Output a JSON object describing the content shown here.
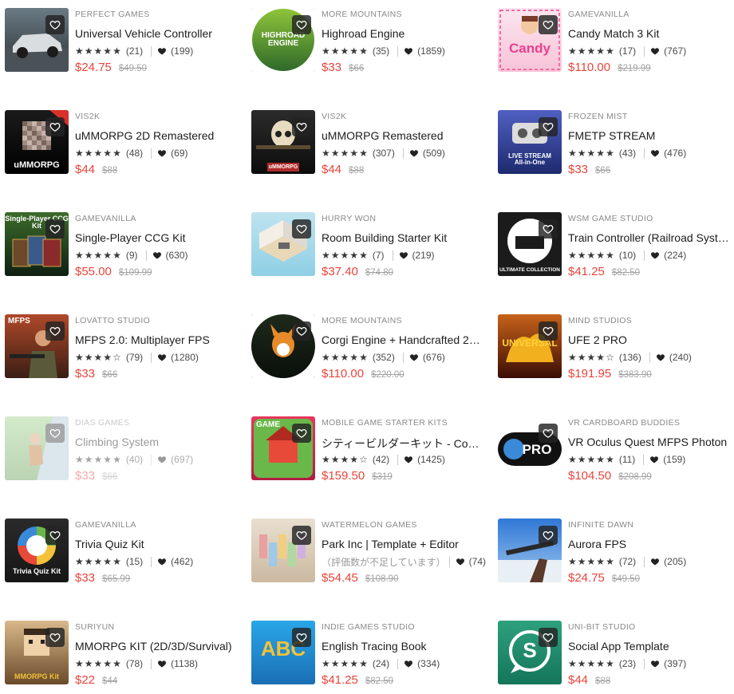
{
  "colors": {
    "sale": "#e8453c",
    "accent": "#212121"
  },
  "cards": [
    {
      "publisher": "PERFECT GAMES",
      "title": "Universal Vehicle Controller",
      "rating": 5,
      "reviews": "(21)",
      "favorites": "(199)",
      "price": "$24.75",
      "original": "$49.50",
      "thumb_icon": "car-thumbnail-icon",
      "bg1": "#6a7b85",
      "bg2": "#2c3134",
      "label": ""
    },
    {
      "publisher": "MORE MOUNTAINS",
      "title": "Highroad Engine",
      "rating": 5,
      "reviews": "(35)",
      "favorites": "(1859)",
      "price": "$33",
      "original": "$66",
      "thumb_icon": "highroad-logo-icon",
      "bg1": "#8fc43a",
      "bg2": "#2e6a2a",
      "label": "HIGHROAD ENGINE"
    },
    {
      "publisher": "GAMEVANILLA",
      "title": "Candy Match 3 Kit",
      "rating": 5,
      "reviews": "(17)",
      "favorites": "(767)",
      "price": "$110.00",
      "original": "$219.99",
      "thumb_icon": "candy-logo-icon",
      "bg1": "#fbe6ef",
      "bg2": "#f8c3d8",
      "label": "Candy"
    },
    {
      "publisher": "VIS2K",
      "title": "uMMORPG 2D Remastered",
      "rating": 5,
      "reviews": "(48)",
      "favorites": "(69)",
      "price": "$44",
      "original": "$88",
      "thumb_icon": "pixel-skull-icon",
      "bg1": "#1b1b1b",
      "bg2": "#000000",
      "label": "uMMORPG"
    },
    {
      "publisher": "VIS2K",
      "title": "uMMORPG Remastered",
      "rating": 5,
      "reviews": "(307)",
      "favorites": "(509)",
      "price": "$44",
      "original": "$88",
      "thumb_icon": "skull-icon",
      "bg1": "#2b2b2b",
      "bg2": "#0c0c0c",
      "label": "uMMORPG"
    },
    {
      "publisher": "FROZEN MIST",
      "title": "FMETP STREAM",
      "rating": 5,
      "reviews": "(43)",
      "favorites": "(476)",
      "price": "$33",
      "original": "$66",
      "thumb_icon": "vr-headset-icon",
      "bg1": "#5060c2",
      "bg2": "#1d2a6e",
      "label": "LIVE STREAM All-in-One"
    },
    {
      "publisher": "GAMEVANILLA",
      "title": "Single-Player CCG Kit",
      "rating": 5,
      "reviews": "(9)",
      "favorites": "(630)",
      "price": "$55.00",
      "original": "$109.99",
      "thumb_icon": "cards-icon",
      "bg1": "#3c6b2a",
      "bg2": "#0f1f12",
      "label": "Single-Player CCG Kit"
    },
    {
      "publisher": "HURRY WON",
      "title": "Room Building Starter Kit",
      "rating": 5,
      "reviews": "(7)",
      "favorites": "(219)",
      "price": "$37.40",
      "original": "$74.80",
      "thumb_icon": "room-icon",
      "bg1": "#bfe3ef",
      "bg2": "#8fcfe5",
      "label": ""
    },
    {
      "publisher": "WSM GAME STUDIO",
      "title": "Train Controller (Railroad System)",
      "rating": 5,
      "reviews": "(10)",
      "favorites": "(224)",
      "price": "$41.25",
      "original": "$82.50",
      "thumb_icon": "train-icon",
      "bg1": "#f08a1c",
      "bg2": "#d55b0f",
      "label": "ULTIMATE COLLECTION"
    },
    {
      "publisher": "LOVATTO STUDIO",
      "title": "MFPS 2.0: Multiplayer FPS",
      "rating": 4,
      "reviews": "(79)",
      "favorites": "(1280)",
      "price": "$33",
      "original": "$66",
      "thumb_icon": "soldier-icon",
      "bg1": "#b0492a",
      "bg2": "#3a1e14",
      "label": "MFPS"
    },
    {
      "publisher": "MORE MOUNTAINS",
      "title": "Corgi Engine + Handcrafted 2D Platformer",
      "rating": 5,
      "reviews": "(352)",
      "favorites": "(676)",
      "price": "$110.00",
      "original": "$220.00",
      "thumb_icon": "corgi-icon",
      "bg1": "#1e2a1c",
      "bg2": "#0a0f0a",
      "label": ""
    },
    {
      "publisher": "MIND STUDIOS",
      "title": "UFE 2 PRO",
      "rating": 4,
      "reviews": "(136)",
      "favorites": "(240)",
      "price": "$191.95",
      "original": "$383.90",
      "thumb_icon": "fire-logo-icon",
      "bg1": "#c8621a",
      "bg2": "#3a0d05",
      "label": "UNIVERSAL"
    },
    {
      "publisher": "DIAS GAMES",
      "title": "Climbing System",
      "rating": 5,
      "reviews": "(40)",
      "favorites": "(697)",
      "price": "$33",
      "original": "$66",
      "thumb_icon": "climber-icon",
      "bg1": "#9fd38c",
      "bg2": "#6aa057",
      "label": "",
      "dim": true
    },
    {
      "publisher": "MOBILE GAME STARTER KITS",
      "title": "シティービルダーキット - Complete City Builder",
      "rating": 4,
      "reviews": "(42)",
      "favorites": "(1425)",
      "price": "$159.50",
      "original": "$319",
      "thumb_icon": "city-icon",
      "bg1": "#e8365d",
      "bg2": "#b01f40",
      "label": "GAME"
    },
    {
      "publisher": "VR CARDBOARD BUDDIES",
      "title": "VR Oculus Quest MFPS Photon",
      "rating": 5,
      "reviews": "(11)",
      "favorites": "(159)",
      "price": "$104.50",
      "original": "$208.99",
      "thumb_icon": "vr-pro-icon",
      "bg1": "#ffffff",
      "bg2": "#ffffff",
      "label": "PRO"
    },
    {
      "publisher": "GAMEVANILLA",
      "title": "Trivia Quiz Kit",
      "rating": 5,
      "reviews": "(15)",
      "favorites": "(462)",
      "price": "$33",
      "original": "$65.99",
      "thumb_icon": "quiz-icon",
      "bg1": "#2a2a2a",
      "bg2": "#161616",
      "label": "Trivia Quiz Kit"
    },
    {
      "publisher": "WATERMELON GAMES",
      "title": "Park Inc | Template + Editor",
      "rating": 0,
      "reviews": "（評価数が不足しています）",
      "favorites": "(74)",
      "price": "$54.45",
      "original": "$108.90",
      "thumb_icon": "park-icon",
      "bg1": "#e9dfd0",
      "bg2": "#cbb9a0",
      "label": ""
    },
    {
      "publisher": "INFINITE DAWN",
      "title": "Aurora FPS",
      "rating": 5,
      "reviews": "(72)",
      "favorites": "(205)",
      "price": "$24.75",
      "original": "$49.50",
      "thumb_icon": "rifle-icon",
      "bg1": "#2f78d6",
      "bg2": "#9fc7ee",
      "label": ""
    },
    {
      "publisher": "SURIYUN",
      "title": "MMORPG KIT (2D/3D/Survival)",
      "rating": 5,
      "reviews": "(78)",
      "favorites": "(1138)",
      "price": "$22",
      "original": "$44",
      "thumb_icon": "voxel-warrior-icon",
      "bg1": "#d9b98a",
      "bg2": "#6a4a2a",
      "label": "MMORPG Kit"
    },
    {
      "publisher": "INDIE GAMES STUDIO",
      "title": "English Tracing Book",
      "rating": 5,
      "reviews": "(24)",
      "favorites": "(334)",
      "price": "$41.25",
      "original": "$82.50",
      "thumb_icon": "abc-icon",
      "bg1": "#2aa6e8",
      "bg2": "#1a6fb5",
      "label": "ABC"
    },
    {
      "publisher": "UNI-BIT STUDIO",
      "title": "Social App Template",
      "rating": 5,
      "reviews": "(23)",
      "favorites": "(397)",
      "price": "$44",
      "original": "$88",
      "thumb_icon": "chat-bubble-icon",
      "bg1": "#2ea07e",
      "bg2": "#14755a",
      "label": "S"
    }
  ]
}
